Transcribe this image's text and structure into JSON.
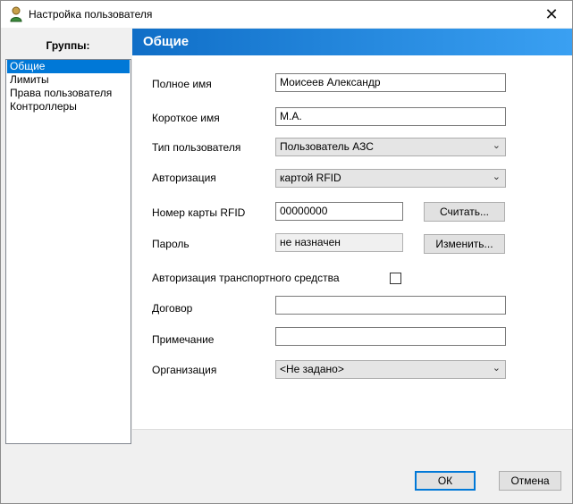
{
  "window": {
    "title": "Настройка пользователя",
    "close_glyph": "✕"
  },
  "groups": {
    "header": "Группы:",
    "items": [
      {
        "label": "Общие",
        "selected": true
      },
      {
        "label": "Лимиты",
        "selected": false
      },
      {
        "label": "Права пользователя",
        "selected": false
      },
      {
        "label": "Контроллеры",
        "selected": false
      }
    ]
  },
  "section": {
    "title": "Общие"
  },
  "form": {
    "full_name": {
      "label": "Полное имя",
      "value": "Моисеев Александр"
    },
    "short_name": {
      "label": "Короткое имя",
      "value": "М.А."
    },
    "user_type": {
      "label": "Тип пользователя",
      "value": "Пользователь АЗС"
    },
    "authorization": {
      "label": "Авторизация",
      "value": "картой RFID"
    },
    "rfid": {
      "label": "Номер карты RFID",
      "value": "00000000",
      "button": "Считать..."
    },
    "password": {
      "label": "Пароль",
      "value": "не назначен",
      "button": "Изменить..."
    },
    "vehicle_auth": {
      "label": "Авторизация транспортного средства",
      "checked": false
    },
    "contract": {
      "label": "Договор",
      "value": ""
    },
    "note": {
      "label": "Примечание",
      "value": ""
    },
    "organization": {
      "label": "Организация",
      "value": "<Не задано>"
    }
  },
  "buttons": {
    "ok": "ОК",
    "cancel": "Отмена"
  },
  "icons": {
    "app": "user-icon",
    "dropdown": "chevron-down-icon"
  }
}
